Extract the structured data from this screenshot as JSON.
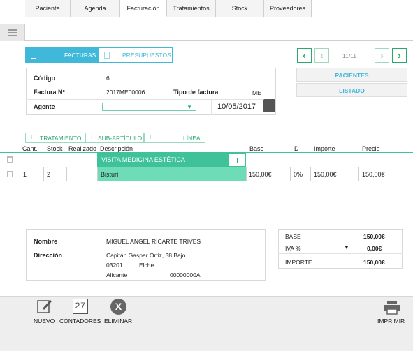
{
  "tabs": [
    "Paciente",
    "Agenda",
    "Facturación",
    "Tratamientos",
    "Stock",
    "Proveedores"
  ],
  "active_tab": "Facturación",
  "segments": {
    "facturas": "FACTURAS",
    "presupuestos": "PRESUPUESTOS"
  },
  "pager": {
    "counter": "11/11"
  },
  "side_buttons": {
    "pacientes": "PACIENTES",
    "listado": "LISTADO"
  },
  "form": {
    "codigo_label": "Código",
    "codigo_value": "6",
    "factura_label": "Factura Nº",
    "factura_value": "2017ME00006",
    "tipo_label": "Tipo de factura",
    "tipo_value": "ME",
    "agente_label": "Agente",
    "fecha_value": "10/05/2017"
  },
  "subtabs": {
    "tratamiento": "TRATAMIENTO",
    "subarticulo": "SUB-ARTÍCULO",
    "linea": "LÍNEA"
  },
  "table": {
    "headers": {
      "cant": "Cant.",
      "stock": "Stock",
      "realizado": "Realizado",
      "descripcion": "Descripción",
      "base": "Base",
      "d": "D",
      "importe": "Importe",
      "precio": "Precio"
    },
    "group_row": "VISITA MEDICINA ESTÉTICA",
    "rows": [
      {
        "cant": "1",
        "stock": "2",
        "descripcion": "Bisturí",
        "base": "150,00€",
        "d": "0%",
        "importe": "150,00€",
        "precio": "150,00€"
      }
    ]
  },
  "patient": {
    "nombre_label": "Nombre",
    "nombre_value": "MIGUEL ANGEL RICARTE TRIVES",
    "direccion_label": "Dirección",
    "address_line1": "Capitán Gaspar Ortiz, 38 Bajo",
    "postcode": "03201",
    "city": "Elche",
    "province": "Alicante",
    "phone": "00000000A"
  },
  "totals": {
    "base_label": "BASE",
    "base_value": "150,00€",
    "iva_label": "IVA %",
    "iva_value": "0,00€",
    "importe_label": "IMPORTE",
    "importe_value": "150,00€"
  },
  "toolbar": {
    "nuevo": "NUEVO",
    "contadores": "CONTADORES",
    "contadores_glyph": "27",
    "eliminar": "ELIMINAR",
    "imprimir": "IMPRIMIR"
  },
  "colors": {
    "accent": "#3fb8d9",
    "green": "#2aa86e",
    "row_highlight": "#6fdcb8"
  }
}
